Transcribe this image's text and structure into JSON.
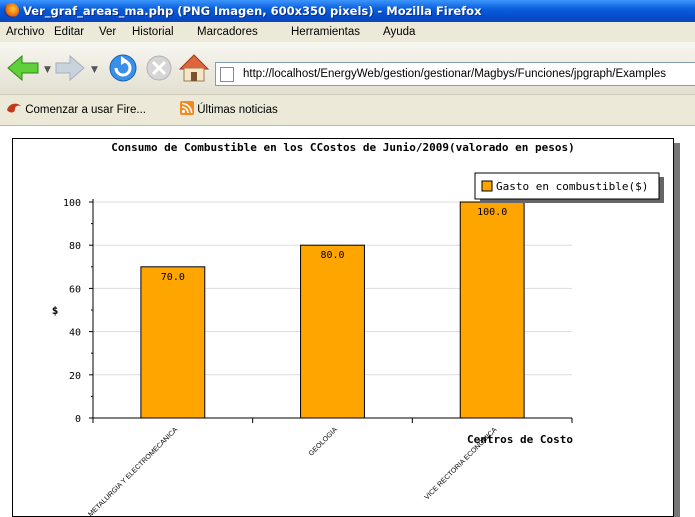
{
  "window": {
    "title": "Ver_graf_areas_ma.php (PNG Imagen, 600x350 pixels) - Mozilla Firefox"
  },
  "menu": {
    "items": [
      "Archivo",
      "Editar",
      "Ver",
      "Historial",
      "Marcadores",
      "Herramientas",
      "Ayuda"
    ]
  },
  "nav": {
    "url": "http://localhost/EnergyWeb/gestion/gestionar/Magbys/Funciones/jpgraph/Examples"
  },
  "bookmarks": {
    "items": [
      "Comenzar a usar Fire...",
      "Últimas noticias"
    ]
  },
  "colors": {
    "bar_fill": "#ffa500",
    "titlebar": "#0a5fdb"
  },
  "chart_data": {
    "type": "bar",
    "title": "Consumo de Combustible en los CCostos de Junio/2009(valorado en pesos)",
    "xlabel": "Centros de Costo",
    "ylabel": "$",
    "categories": [
      "METALURGIA Y ELECTROMECANICA",
      "GEOLOGIA",
      "VICE RECTORIA ECONOMICA"
    ],
    "series": [
      {
        "name": "Gasto en combustible($)",
        "values": [
          70,
          80,
          100
        ]
      }
    ],
    "data_labels": [
      "70.0",
      "80.0",
      "100.0"
    ],
    "ylim": [
      0,
      100
    ],
    "yticks": [
      "0",
      "20",
      "40",
      "60",
      "80",
      "100"
    ],
    "grid": true,
    "legend": "top-right"
  }
}
